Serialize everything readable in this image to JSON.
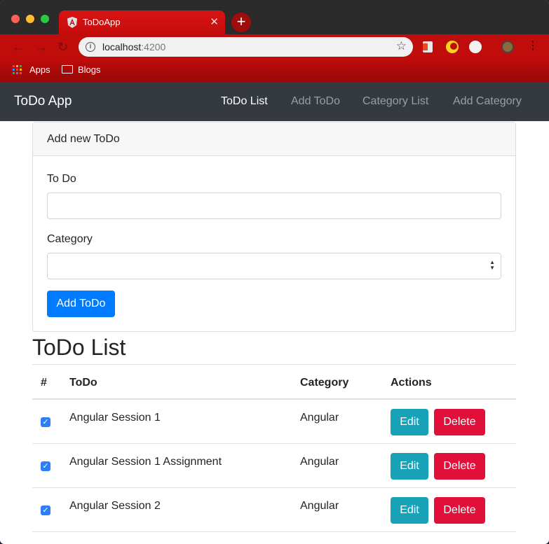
{
  "browser": {
    "tab_title": "ToDoApp",
    "tab_close": "✕",
    "new_tab": "+",
    "url_host": "localhost",
    "url_port": ":4200",
    "bookmarks": [
      "Apps",
      "Blogs"
    ]
  },
  "navbar": {
    "brand": "ToDo App",
    "links": [
      {
        "label": "ToDo List",
        "active": true
      },
      {
        "label": "Add ToDo",
        "active": false
      },
      {
        "label": "Category List",
        "active": false
      },
      {
        "label": "Add Category",
        "active": false
      }
    ]
  },
  "form": {
    "header": "Add new ToDo",
    "todo_label": "To Do",
    "todo_value": "",
    "category_label": "Category",
    "category_value": "",
    "submit_label": "Add ToDo"
  },
  "list": {
    "heading": "ToDo List",
    "columns": [
      "#",
      "ToDo",
      "Category",
      "Actions"
    ],
    "rows": [
      {
        "done": true,
        "todo": "Angular Session 1",
        "category": "Angular",
        "edit": "Edit",
        "delete": "Delete"
      },
      {
        "done": true,
        "todo": "Angular Session 1 Assignment",
        "category": "Angular",
        "edit": "Edit",
        "delete": "Delete"
      },
      {
        "done": true,
        "todo": "Angular Session 2",
        "category": "Angular",
        "edit": "Edit",
        "delete": "Delete"
      }
    ]
  },
  "colors": {
    "browser_red": "#c10c0c",
    "navbar": "#343a40",
    "primary": "#007bff",
    "info": "#17a2b8",
    "danger": "#e0103a"
  }
}
